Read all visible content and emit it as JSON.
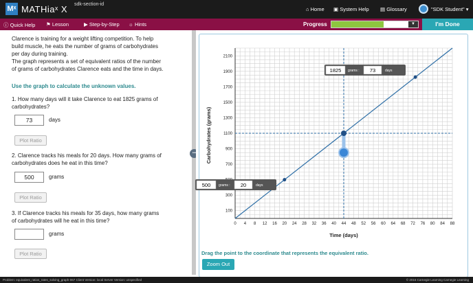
{
  "header": {
    "logo": "Mˣ",
    "app_name": "MATHiaˣ X",
    "section_id": "sdk-section-id",
    "nav": [
      "Home",
      "System Help",
      "Glossary"
    ],
    "user": "\"SDK Student\""
  },
  "toolbar": {
    "items": [
      "Quick Help",
      "Lesson",
      "Step-by-Step",
      "Hints"
    ],
    "progress_label": "Progress",
    "progress_fraction": 0.6,
    "done_label": "I'm Done"
  },
  "problem": {
    "intro": [
      "Clarence is training for a weight lifting competition. To help",
      "build muscle, he eats the number of grams of carbohydrates",
      "per day during training.",
      "The graph represents a set of equivalent ratios of the number",
      "of grams of carbohydrates Clarence eats and the time in days."
    ],
    "instruction": "Use the graph to calculate the unknown values.",
    "questions": [
      {
        "lines": [
          "1.  How many days will it take Clarence to eat 1825 grams of",
          "carbohydrates?"
        ],
        "answer": "73",
        "unit": "days",
        "plot_label": "Plot Ratio"
      },
      {
        "lines": [
          "2.  Clarence tracks his meals for 20 days. How many grams of",
          "carbohydrates does he eat in this time?"
        ],
        "answer": "500",
        "unit": "grams",
        "plot_label": "Plot Ratio"
      },
      {
        "lines": [
          "3.  If Clarence tracks his meals for 35 days, how many grams",
          "of carbohydrates will he eat in this time?"
        ],
        "answer": "",
        "unit": "grams",
        "plot_label": "Plot Ratio"
      }
    ]
  },
  "graph": {
    "instruction": "Drag the point to the coordinate that represents the equivalent ratio.",
    "zoom_label": "Zoom Out",
    "callouts": [
      {
        "grams": "1825",
        "sep": "grams :",
        "days": "73",
        "unit": "days"
      },
      {
        "grams": "500",
        "sep": "grams :",
        "days": "20",
        "unit": "days"
      }
    ]
  },
  "chart_data": {
    "type": "line",
    "xlabel": "Time (days)",
    "ylabel": "Carbohydrates (grams)",
    "xlim": [
      0,
      88
    ],
    "ylim": [
      0,
      2200
    ],
    "x_ticks": [
      0,
      4,
      8,
      12,
      16,
      20,
      24,
      28,
      32,
      36,
      40,
      44,
      48,
      52,
      56,
      60,
      64,
      68,
      72,
      76,
      80,
      84,
      88
    ],
    "y_ticks": [
      100,
      300,
      500,
      700,
      900,
      1100,
      1300,
      1500,
      1700,
      1900,
      2100
    ],
    "line": {
      "slope": 25,
      "x_range": [
        0,
        88
      ]
    },
    "points": [
      {
        "x": 20,
        "y": 500
      },
      {
        "x": 44,
        "y": 1100
      },
      {
        "x": 73,
        "y": 1825
      }
    ],
    "drag_point": {
      "x": 44,
      "y": 850
    },
    "guide": {
      "x": 44,
      "y": 1100
    },
    "grid": true
  },
  "status": {
    "left": "Problem: equivalent_ratios_rates_solving_graph-067   Client Version: local   Server Version: unspecified",
    "right": "© 2016 Carnegie Learning    Carnegie Learning"
  }
}
